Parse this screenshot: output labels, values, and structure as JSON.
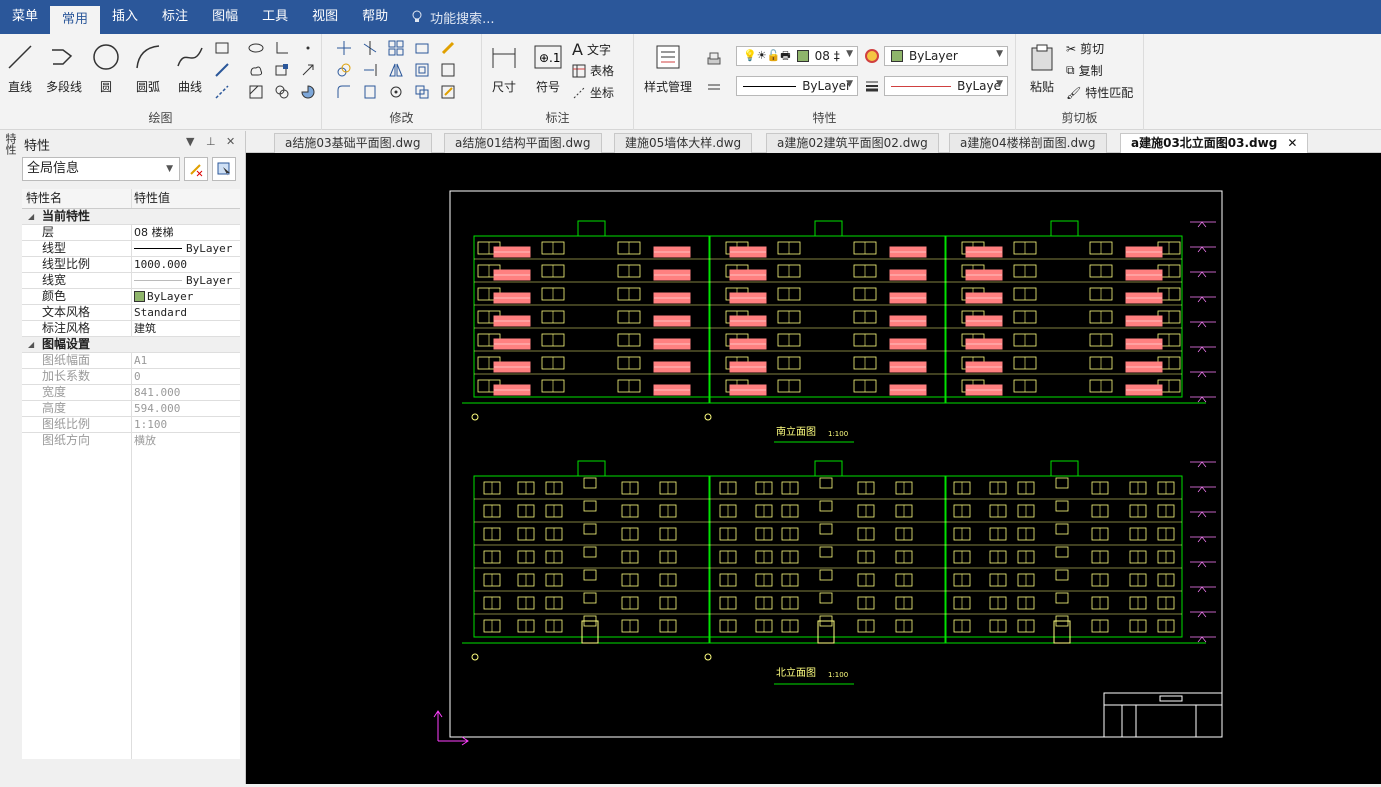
{
  "menu": {
    "items": [
      "菜单",
      "常用",
      "插入",
      "标注",
      "图幅",
      "工具",
      "视图",
      "帮助"
    ],
    "active": "常用",
    "search_placeholder": "功能搜索..."
  },
  "ribbon": {
    "draw": {
      "label": "绘图",
      "line": "直线",
      "polyline": "多段线",
      "circle": "圆",
      "arc": "圆弧",
      "curve": "曲线"
    },
    "modify": {
      "label": "修改"
    },
    "annotate": {
      "label": "标注",
      "dimension": "尺寸",
      "symbol": "符号",
      "text": "文字",
      "table": "表格",
      "coordinate": "坐标"
    },
    "properties": {
      "label": "特性",
      "style_manager": "样式管理",
      "layer_value": "08 ‡",
      "color_value": "ByLayer",
      "linetype_value": "ByLayer",
      "lineweight_value": "ByLaye"
    },
    "clipboard": {
      "label": "剪切板",
      "paste": "粘贴",
      "cut": "剪切",
      "copy": "复制",
      "match": "特性匹配"
    }
  },
  "panel": {
    "title": "特性",
    "side_tab": "特性",
    "selection": "全局信息",
    "col_name": "特性名",
    "col_value": "特性值",
    "section_current": "当前特性",
    "current": [
      {
        "k": "层",
        "v": "08 楼梯"
      },
      {
        "k": "线型",
        "v": "ByLayer"
      },
      {
        "k": "线型比例",
        "v": "1000.000"
      },
      {
        "k": "线宽",
        "v": "ByLayer"
      },
      {
        "k": "颜色",
        "v": "ByLayer"
      },
      {
        "k": "文本风格",
        "v": "Standard"
      },
      {
        "k": "标注风格",
        "v": "建筑"
      }
    ],
    "section_sheet": "图幅设置",
    "sheet": [
      {
        "k": "图纸幅面",
        "v": "A1"
      },
      {
        "k": "加长系数",
        "v": "0"
      },
      {
        "k": "宽度",
        "v": "841.000"
      },
      {
        "k": "高度",
        "v": "594.000"
      },
      {
        "k": "图纸比例",
        "v": "1:100"
      },
      {
        "k": "图纸方向",
        "v": "横放"
      }
    ]
  },
  "tabs": [
    "a结施03基础平面图.dwg",
    "a结施01结构平面图.dwg",
    "建施05墙体大样.dwg",
    "a建施02建筑平面图02.dwg",
    "a建施04楼梯剖面图.dwg",
    "a建施03北立面图03.dwg"
  ],
  "active_tab": 5,
  "drawing": {
    "south_title": "南立面图",
    "north_title": "北立面图",
    "scale": "1:100"
  },
  "colors": {
    "accent": "#2b579a",
    "green": "#00e000",
    "yellow": "#ffff80",
    "balcony": "#ff8080",
    "magenta": "#ff40ff"
  }
}
